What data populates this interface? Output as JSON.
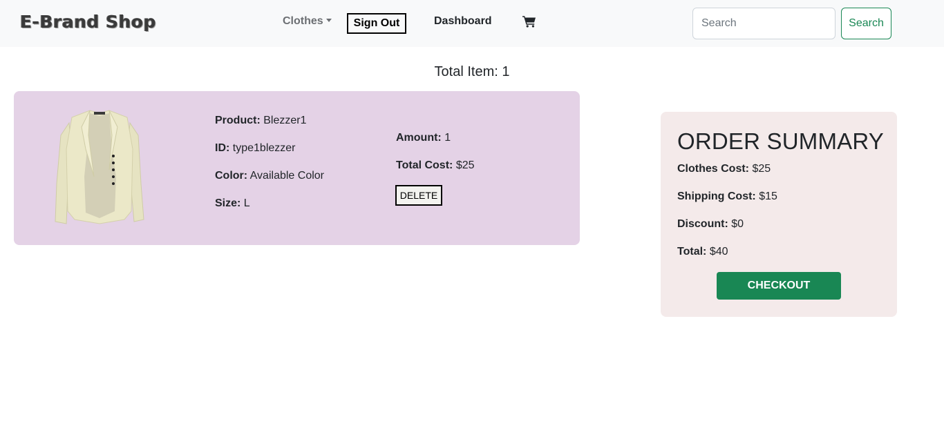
{
  "navbar": {
    "brand": "E-Brand Shop",
    "clothes_label": "Clothes",
    "signout_label": "Sign Out",
    "dashboard_label": "Dashboard",
    "cart_icon": "cart-icon",
    "search_placeholder": "Search",
    "search_value": "",
    "search_button": "Search"
  },
  "cart": {
    "total_item_text": "Total Item: 1",
    "items": [
      {
        "product_label": "Product:",
        "product_value": "Blezzer1",
        "id_label": "ID:",
        "id_value": "type1blezzer",
        "color_label": "Color:",
        "color_value": "Available Color",
        "size_label": "Size:",
        "size_value": "L",
        "amount_label": "Amount:",
        "amount_value": "1",
        "total_cost_label": "Total Cost:",
        "total_cost_value": "$25",
        "delete_label": "DELETE"
      }
    ]
  },
  "summary": {
    "title": "ORDER SUMMARY",
    "clothes_cost_label": "Clothes Cost:",
    "clothes_cost_value": "$25",
    "shipping_cost_label": "Shipping Cost:",
    "shipping_cost_value": "$15",
    "discount_label": "Discount:",
    "discount_value": "$0",
    "total_label": "Total:",
    "total_value": "$40",
    "checkout_label": "CHECKOUT"
  },
  "colors": {
    "navbar_bg": "#f8f9fa",
    "card_bg": "#e4d2e6",
    "summary_bg": "#f4eaea",
    "success": "#198754"
  }
}
